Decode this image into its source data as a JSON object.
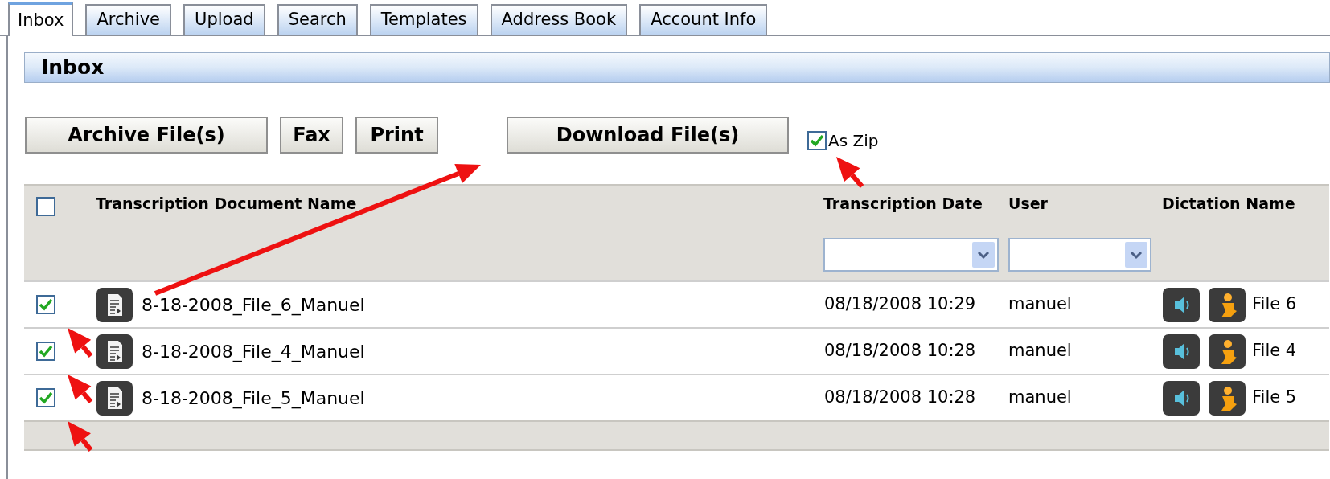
{
  "tabs": [
    {
      "label": "Inbox",
      "selected": true
    },
    {
      "label": "Archive",
      "selected": false
    },
    {
      "label": "Upload",
      "selected": false
    },
    {
      "label": "Search",
      "selected": false
    },
    {
      "label": "Templates",
      "selected": false
    },
    {
      "label": "Address Book",
      "selected": false
    },
    {
      "label": "Account Info",
      "selected": false
    }
  ],
  "section_title": "Inbox",
  "toolbar": {
    "buttons": [
      "Archive File(s)",
      "Fax",
      "Print",
      "Download File(s)"
    ],
    "as_zip": {
      "label": "As Zip",
      "checked": true
    }
  },
  "table": {
    "select_all": {
      "checked": false
    },
    "columns": [
      {
        "label": "Transcription Document Name",
        "filter": false
      },
      {
        "label": "Transcription Date",
        "filter": true
      },
      {
        "label": "User",
        "filter": true
      },
      {
        "label": "Dictation Name",
        "filter": false
      }
    ],
    "rows": [
      {
        "checked": true,
        "document": "8-18-2008_File_6_Manuel",
        "date": "08/18/2008 10:29",
        "user": "manuel",
        "dictation": "File 6"
      },
      {
        "checked": true,
        "document": "8-18-2008_File_4_Manuel",
        "date": "08/18/2008 10:28",
        "user": "manuel",
        "dictation": "File 4"
      },
      {
        "checked": true,
        "document": "8-18-2008_File_5_Manuel",
        "date": "08/18/2008 10:28",
        "user": "manuel",
        "dictation": "File 5"
      }
    ]
  }
}
